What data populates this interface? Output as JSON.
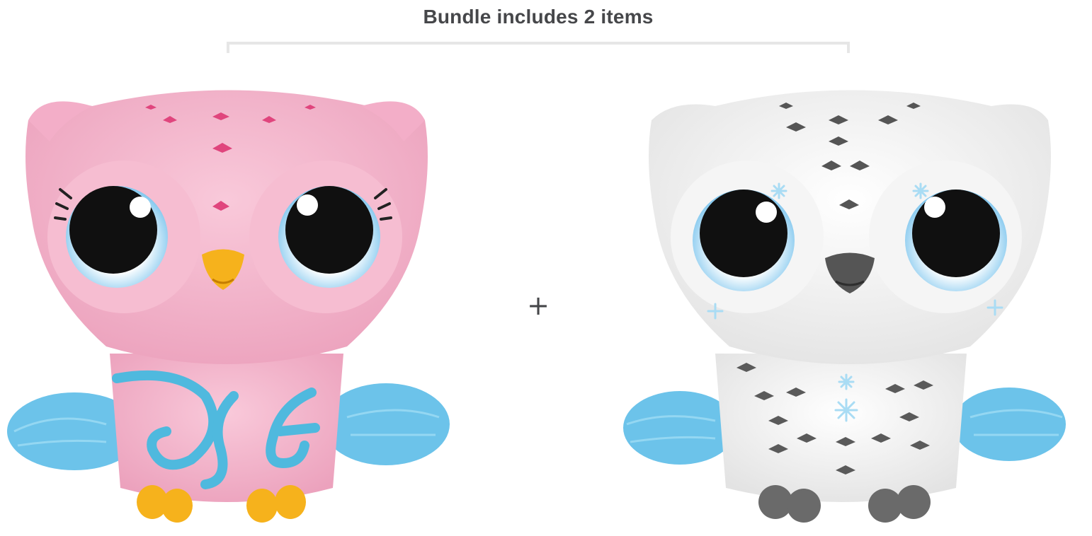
{
  "bundle": {
    "title": "Bundle includes 2 items",
    "separator": "+"
  },
  "items": [
    {
      "image": "owl-toy-pink-icon",
      "body_color": "#f4b5cc",
      "accent_color": "#e0457d",
      "beak_color": "#f6b21c",
      "fluff_color": "#6cc3ea"
    },
    {
      "image": "owl-toy-white-icon",
      "body_color": "#f3f3f3",
      "accent_color": "#5a5a5a",
      "beak_color": "#555555",
      "fluff_color": "#6cc3ea"
    }
  ]
}
